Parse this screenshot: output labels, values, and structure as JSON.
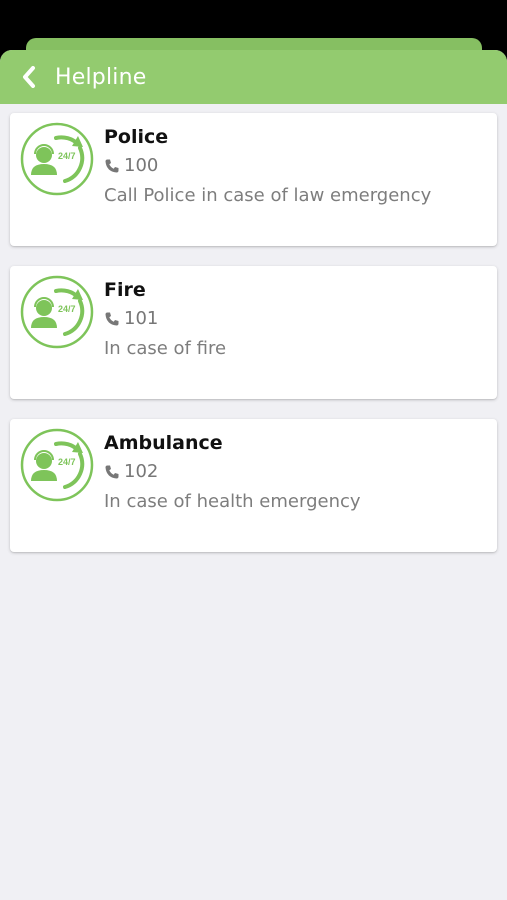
{
  "header": {
    "title": "Helpline",
    "back_icon": "chevron-left-icon"
  },
  "colors": {
    "accent": "#93cb6f",
    "icon_green": "#7ec45a",
    "background": "#f0f0f4",
    "card": "#ffffff"
  },
  "contacts": [
    {
      "name": "Police",
      "number": "100",
      "description": "Call Police in case of law emergency",
      "icon": "support-24-7-icon",
      "icon_label": "24/7"
    },
    {
      "name": "Fire",
      "number": "101",
      "description": "In case of fire",
      "icon": "support-24-7-icon",
      "icon_label": "24/7"
    },
    {
      "name": "Ambulance",
      "number": "102",
      "description": "In case of health emergency",
      "icon": "support-24-7-icon",
      "icon_label": "24/7"
    }
  ]
}
